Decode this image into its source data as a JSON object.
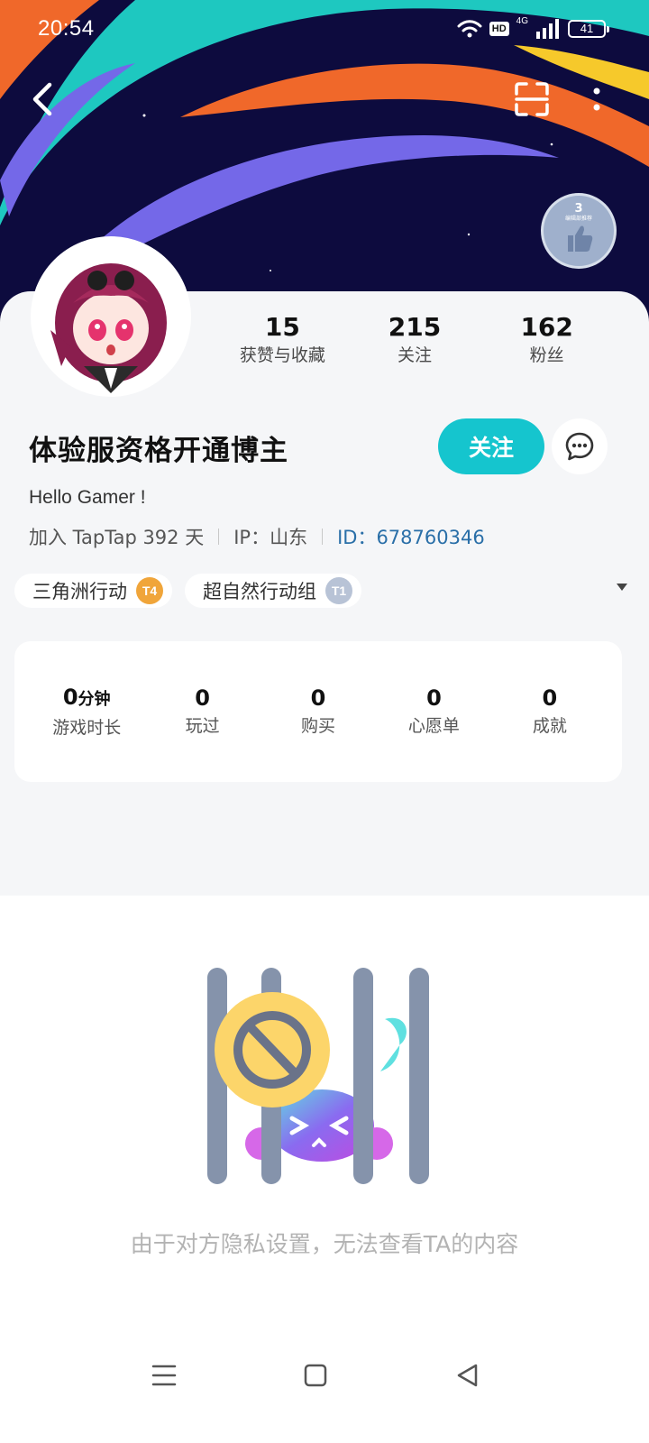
{
  "status_bar": {
    "time": "20:54",
    "hd": "HD",
    "network": "4G",
    "battery": "41"
  },
  "banner": {
    "colors": {
      "navy": "#0d0b3e",
      "teal": "#1ec8c0",
      "orange": "#f0682a",
      "purple": "#7468e8",
      "yellow": "#f6c92b"
    },
    "medal": {
      "number": "3",
      "text": "编辑部推荐"
    }
  },
  "profile": {
    "name": "体验服资格开通博主",
    "bio": "Hello Gamer !",
    "joined": "加入 TapTap 392 天",
    "ip": "IP：山东",
    "id": "ID：678760346",
    "stats": [
      {
        "value": "15",
        "label": "获赞与收藏"
      },
      {
        "value": "215",
        "label": "关注"
      },
      {
        "value": "162",
        "label": "粉丝"
      }
    ],
    "follow_label": "关注"
  },
  "tags": [
    {
      "label": "三角洲行动",
      "icon_text": "T4",
      "icon_color": "#f0a53a"
    },
    {
      "label": "超自然行动组",
      "icon_text": "T1",
      "icon_color": "#b8c3d6"
    }
  ],
  "summary": {
    "items": [
      {
        "value": "0",
        "unit": "分钟",
        "label": "游戏时长"
      },
      {
        "value": "0",
        "unit": "",
        "label": "玩过"
      },
      {
        "value": "0",
        "unit": "",
        "label": "购买"
      },
      {
        "value": "0",
        "unit": "",
        "label": "心愿单"
      },
      {
        "value": "0",
        "unit": "",
        "label": "成就"
      }
    ]
  },
  "empty_state": {
    "message": "由于对方隐私设置，无法查看TA的内容"
  },
  "accent_color": "#15c5ce"
}
